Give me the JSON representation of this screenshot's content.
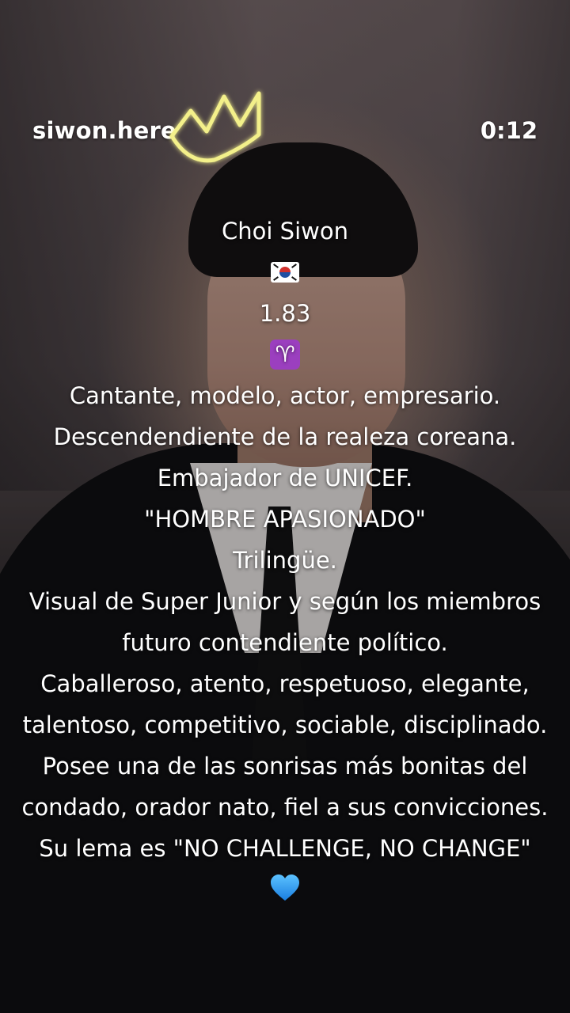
{
  "header": {
    "username": "siwon.here",
    "timer": "0:12"
  },
  "caption": {
    "lines": [
      "Choi Siwon",
      "1.83",
      "Cantante, modelo, actor, empresario.",
      "Descendendiente de la realeza coreana.",
      "Embajador de UNICEF.",
      "\"HOMBRE APASIONADO\"",
      "Trilingüe.",
      "Visual de Super Junior y según los miembros",
      "futuro contendiente político.",
      "Caballeroso, atento, respetuoso, elegante,",
      "talentoso, competitivo, sociable, disciplinado.",
      "Posee una de las sonrisas más bonitas del",
      "condado, orador nato, fiel a sus convicciones.",
      "Su lema es \"NO CHALLENGE, NO CHANGE\""
    ]
  },
  "icons": {
    "crown": "crown-icon",
    "flag": "south-korea-flag-icon",
    "zodiac": "aries-icon",
    "heart": "blue-heart-icon"
  },
  "colors": {
    "text": "#ffffff",
    "crown": "#f3f08a",
    "aries_bg": "#9b3fbf",
    "heart": "#2a9df4"
  }
}
